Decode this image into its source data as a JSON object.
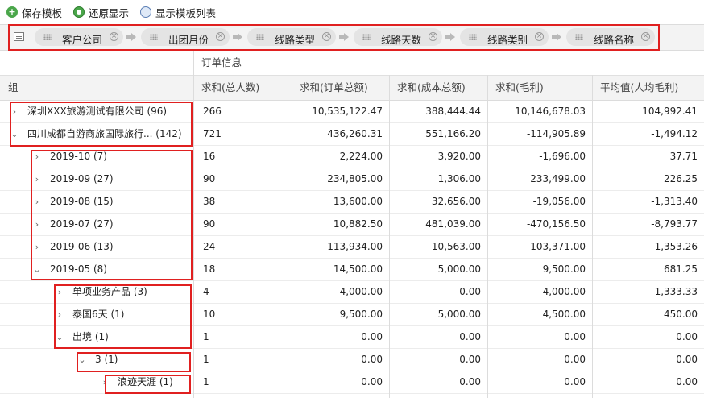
{
  "toolbar": {
    "save_template": "保存模板",
    "restore_display": "还原显示",
    "show_template_list": "显示模板列表"
  },
  "group_chips": [
    "客户公司",
    "出团月份",
    "线路类型",
    "线路天数",
    "线路类别",
    "线路名称"
  ],
  "header": {
    "band_label": "订单信息",
    "group_col": "组",
    "columns": [
      "求和(总人数)",
      "求和(订单总额)",
      "求和(成本总额)",
      "求和(毛利)",
      "平均值(人均毛利)"
    ]
  },
  "rows": [
    {
      "label": "深圳XXX旅游测试有限公司 (96)",
      "toggle": "›",
      "level": 0,
      "values": [
        "266",
        "10,535,122.47",
        "388,444.44",
        "10,146,678.03",
        "104,992.41"
      ]
    },
    {
      "label": "四川成都自游商旅国际旅行... (142)",
      "toggle": "⌄",
      "level": 0,
      "values": [
        "721",
        "436,260.31",
        "551,166.20",
        "-114,905.89",
        "-1,494.12"
      ]
    },
    {
      "label": "2019-10 (7)",
      "toggle": "›",
      "level": 1,
      "values": [
        "16",
        "2,224.00",
        "3,920.00",
        "-1,696.00",
        "37.71"
      ]
    },
    {
      "label": "2019-09 (27)",
      "toggle": "›",
      "level": 1,
      "values": [
        "90",
        "234,805.00",
        "1,306.00",
        "233,499.00",
        "226.25"
      ]
    },
    {
      "label": "2019-08 (15)",
      "toggle": "›",
      "level": 1,
      "values": [
        "38",
        "13,600.00",
        "32,656.00",
        "-19,056.00",
        "-1,313.40"
      ]
    },
    {
      "label": "2019-07 (27)",
      "toggle": "›",
      "level": 1,
      "values": [
        "90",
        "10,882.50",
        "481,039.00",
        "-470,156.50",
        "-8,793.77"
      ]
    },
    {
      "label": "2019-06 (13)",
      "toggle": "›",
      "level": 1,
      "values": [
        "24",
        "113,934.00",
        "10,563.00",
        "103,371.00",
        "1,353.26"
      ]
    },
    {
      "label": "2019-05 (8)",
      "toggle": "⌄",
      "level": 1,
      "values": [
        "18",
        "14,500.00",
        "5,000.00",
        "9,500.00",
        "681.25"
      ]
    },
    {
      "label": "单项业务产品 (3)",
      "toggle": "›",
      "level": 2,
      "values": [
        "4",
        "4,000.00",
        "0.00",
        "4,000.00",
        "1,333.33"
      ]
    },
    {
      "label": "泰国6天 (1)",
      "toggle": "›",
      "level": 2,
      "values": [
        "10",
        "9,500.00",
        "5,000.00",
        "4,500.00",
        "450.00"
      ]
    },
    {
      "label": "出境 (1)",
      "toggle": "⌄",
      "level": 2,
      "values": [
        "1",
        "0.00",
        "0.00",
        "0.00",
        "0.00"
      ]
    },
    {
      "label": "3 (1)",
      "toggle": "⌄",
      "level": 3,
      "values": [
        "1",
        "0.00",
        "0.00",
        "0.00",
        "0.00"
      ]
    },
    {
      "label": "浪迹天涯 (1)",
      "toggle": "›",
      "level": 4,
      "values": [
        "1",
        "0.00",
        "0.00",
        "0.00",
        "0.00"
      ]
    }
  ]
}
